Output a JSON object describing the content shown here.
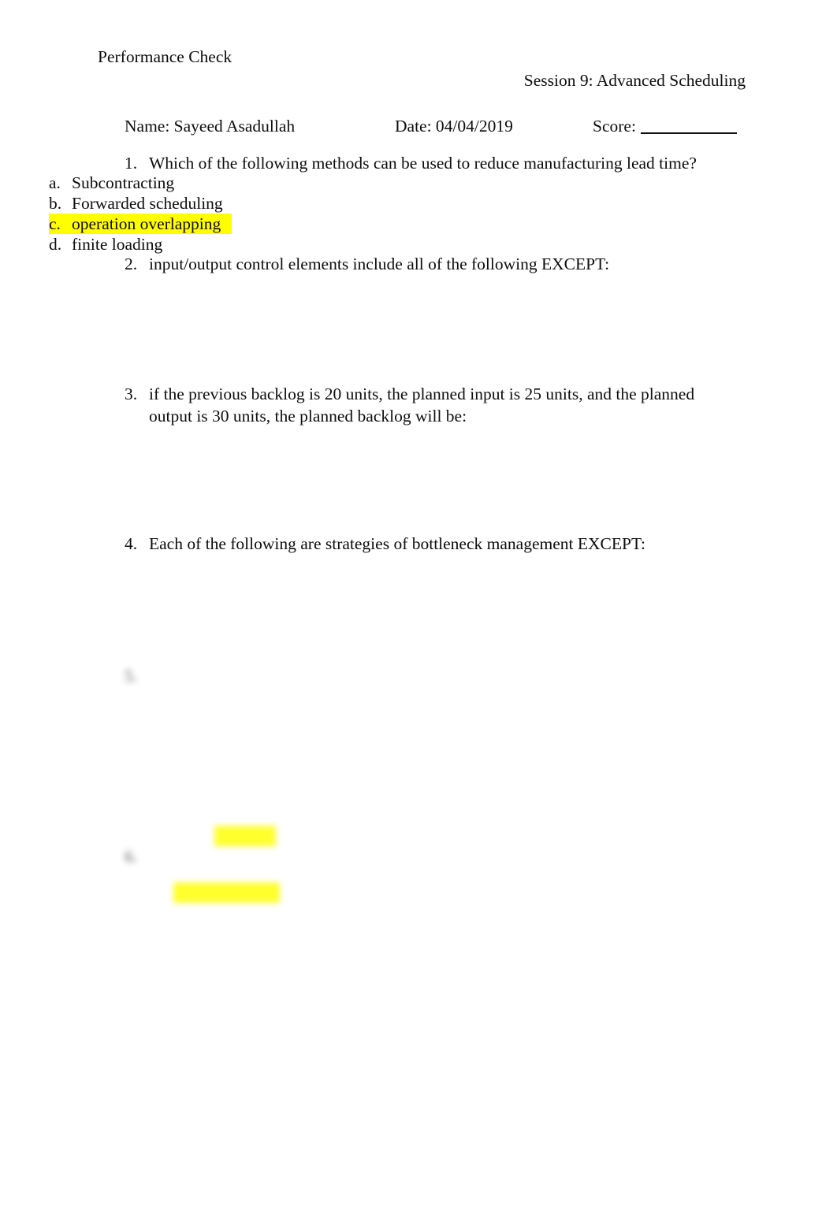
{
  "document": {
    "header_left": "Performance Check",
    "header_right": "Session 9: Advanced Scheduling",
    "identity": {
      "name_label": "Name: Sayeed Asadullah",
      "date_label": "Date: 04/04/2019",
      "score_label": "Score:",
      "score_value": ""
    },
    "highlight_color": "#ffff00",
    "text_color": "#0d0d0d",
    "page_color": "#ffffff"
  },
  "questions": [
    {
      "number": "1.",
      "text": "Which of the following methods can be used to reduce manufacturing lead time?",
      "options": [
        {
          "mark": "a.",
          "text": "Subcontracting",
          "highlighted": false
        },
        {
          "mark": "b.",
          "text": "Forwarded scheduling",
          "highlighted": false
        },
        {
          "mark": "c.",
          "text": "operation overlapping",
          "highlighted": true
        },
        {
          "mark": "d.",
          "text": "finite loading",
          "highlighted": false
        }
      ]
    },
    {
      "number": "2.",
      "text": "input/output control elements include all of the following EXCEPT:",
      "options": []
    },
    {
      "number": "3.",
      "text": "if the previous backlog is 20 units, the planned input is 25 units, and the planned output is 30 units, the planned backlog will be:",
      "options": []
    },
    {
      "number": "4.",
      "text": "Each of the following are strategies of bottleneck management EXCEPT:",
      "options": []
    }
  ],
  "blurred_section": {
    "note_visible_state": "out-of-focus",
    "questions": [
      {
        "number": "5.",
        "text": "",
        "table": {
          "header": {
            "mark": "",
            "col1": "",
            "col2": ""
          },
          "rows": [
            {
              "mark": "",
              "col1": "",
              "col2": ""
            },
            {
              "mark": "",
              "col1": "",
              "col2": ""
            },
            {
              "mark": "",
              "col1": "",
              "col2": ""
            }
          ]
        },
        "options": [
          {
            "mark": "",
            "text": "",
            "highlighted": false
          },
          {
            "mark": "",
            "text": "",
            "highlighted": false
          },
          {
            "mark": "",
            "text": "",
            "highlighted": false
          },
          {
            "mark": "",
            "text": "",
            "highlighted": true
          }
        ]
      },
      {
        "number": "6.",
        "text": "",
        "text_line2": "",
        "options": [
          {
            "mark": "",
            "text": "",
            "highlighted": true
          },
          {
            "mark": "",
            "text": "",
            "highlighted": false
          },
          {
            "mark": "",
            "text": "",
            "highlighted": false
          },
          {
            "mark": "",
            "text": "",
            "highlighted": false
          }
        ]
      }
    ]
  }
}
